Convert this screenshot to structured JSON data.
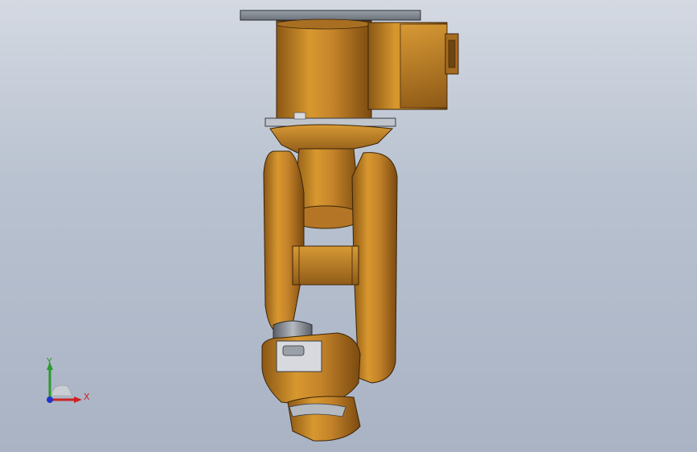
{
  "viewport": {
    "background_top": "#d4d9e2",
    "background_bottom": "#a9b3c4"
  },
  "model": {
    "part_color": "#c8892b",
    "part_shadow": "#7a4f12",
    "mount_plate_color": "#8a8f98"
  },
  "triad": {
    "y_label": "Y",
    "x_label": "X",
    "y_color": "#2a9a2a",
    "x_color": "#cc2222",
    "z_color": "#2233cc"
  }
}
